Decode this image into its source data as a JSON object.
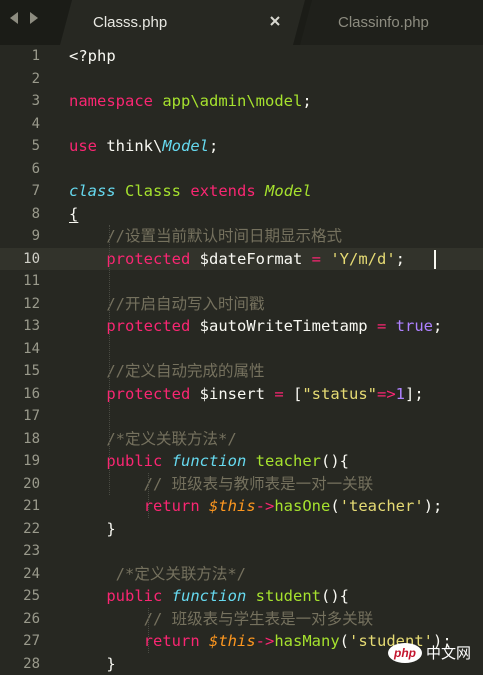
{
  "tabs": [
    {
      "label": "Classs.php"
    },
    {
      "label": "Classinfo.php"
    }
  ],
  "current_line": 10,
  "lines": [
    {
      "n": "1",
      "tokens": [
        {
          "t": "<?php",
          "c": "var"
        }
      ]
    },
    {
      "n": "2",
      "tokens": []
    },
    {
      "n": "3",
      "tokens": [
        {
          "t": "namespace",
          "c": "kw"
        },
        {
          "t": " ",
          "c": "var"
        },
        {
          "t": "app\\admin\\model",
          "c": "ns"
        },
        {
          "t": ";",
          "c": "var"
        }
      ]
    },
    {
      "n": "4",
      "tokens": []
    },
    {
      "n": "5",
      "tokens": [
        {
          "t": "use",
          "c": "kw"
        },
        {
          "t": " think\\",
          "c": "var"
        },
        {
          "t": "Model",
          "c": "typ"
        },
        {
          "t": ";",
          "c": "var"
        }
      ]
    },
    {
      "n": "6",
      "tokens": []
    },
    {
      "n": "7",
      "tokens": [
        {
          "t": "class",
          "c": "sto"
        },
        {
          "t": " ",
          "c": "var"
        },
        {
          "t": "Classs",
          "c": "cls"
        },
        {
          "t": " ",
          "c": "var"
        },
        {
          "t": "extends",
          "c": "kw"
        },
        {
          "t": " ",
          "c": "var"
        },
        {
          "t": "Model",
          "c": "cls ital"
        }
      ]
    },
    {
      "n": "8",
      "tokens": [
        {
          "t": "{",
          "c": "var ul"
        }
      ]
    },
    {
      "n": "9",
      "tokens": [
        {
          "t": "    ",
          "c": "var"
        },
        {
          "t": "//设置当前默认时间日期显示格式",
          "c": "com"
        }
      ]
    },
    {
      "n": "10",
      "tokens": [
        {
          "t": "    ",
          "c": "var"
        },
        {
          "t": "protected",
          "c": "kw"
        },
        {
          "t": " $dateFormat ",
          "c": "var"
        },
        {
          "t": "=",
          "c": "op"
        },
        {
          "t": " ",
          "c": "var"
        },
        {
          "t": "'Y/m/d'",
          "c": "str"
        },
        {
          "t": ";",
          "c": "var"
        }
      ]
    },
    {
      "n": "11",
      "tokens": []
    },
    {
      "n": "12",
      "tokens": [
        {
          "t": "    ",
          "c": "var"
        },
        {
          "t": "//开启自动写入时间戳",
          "c": "com"
        }
      ]
    },
    {
      "n": "13",
      "tokens": [
        {
          "t": "    ",
          "c": "var"
        },
        {
          "t": "protected",
          "c": "kw"
        },
        {
          "t": " $autoWriteTimetamp ",
          "c": "var"
        },
        {
          "t": "=",
          "c": "op"
        },
        {
          "t": " ",
          "c": "var"
        },
        {
          "t": "true",
          "c": "const"
        },
        {
          "t": ";",
          "c": "var"
        }
      ]
    },
    {
      "n": "14",
      "tokens": []
    },
    {
      "n": "15",
      "tokens": [
        {
          "t": "    ",
          "c": "var"
        },
        {
          "t": "//定义自动完成的属性",
          "c": "com"
        }
      ]
    },
    {
      "n": "16",
      "tokens": [
        {
          "t": "    ",
          "c": "var"
        },
        {
          "t": "protected",
          "c": "kw"
        },
        {
          "t": " $insert ",
          "c": "var"
        },
        {
          "t": "=",
          "c": "op"
        },
        {
          "t": " [",
          "c": "var"
        },
        {
          "t": "\"status\"",
          "c": "str"
        },
        {
          "t": "=>",
          "c": "op"
        },
        {
          "t": "1",
          "c": "num"
        },
        {
          "t": "];",
          "c": "var"
        }
      ]
    },
    {
      "n": "17",
      "tokens": []
    },
    {
      "n": "18",
      "tokens": [
        {
          "t": "    ",
          "c": "var"
        },
        {
          "t": "/*定义关联方法*/",
          "c": "com"
        }
      ]
    },
    {
      "n": "19",
      "tokens": [
        {
          "t": "    ",
          "c": "var"
        },
        {
          "t": "public",
          "c": "kw"
        },
        {
          "t": " ",
          "c": "var"
        },
        {
          "t": "function",
          "c": "sto"
        },
        {
          "t": " ",
          "c": "var"
        },
        {
          "t": "teacher",
          "c": "fn"
        },
        {
          "t": "(){",
          "c": "var"
        }
      ]
    },
    {
      "n": "20",
      "tokens": [
        {
          "t": "        ",
          "c": "var"
        },
        {
          "t": "// 班级表与教师表是一对一关联",
          "c": "com"
        }
      ]
    },
    {
      "n": "21",
      "tokens": [
        {
          "t": "        ",
          "c": "var"
        },
        {
          "t": "return",
          "c": "kw"
        },
        {
          "t": " ",
          "c": "var"
        },
        {
          "t": "$this",
          "c": "thisv"
        },
        {
          "t": "->",
          "c": "op"
        },
        {
          "t": "hasOne",
          "c": "fn"
        },
        {
          "t": "(",
          "c": "var"
        },
        {
          "t": "'teacher'",
          "c": "str"
        },
        {
          "t": ");",
          "c": "var"
        }
      ]
    },
    {
      "n": "22",
      "tokens": [
        {
          "t": "    }",
          "c": "var"
        }
      ]
    },
    {
      "n": "23",
      "tokens": []
    },
    {
      "n": "24",
      "tokens": [
        {
          "t": "     ",
          "c": "var"
        },
        {
          "t": "/*定义关联方法*/",
          "c": "com"
        }
      ]
    },
    {
      "n": "25",
      "tokens": [
        {
          "t": "    ",
          "c": "var"
        },
        {
          "t": "public",
          "c": "kw"
        },
        {
          "t": " ",
          "c": "var"
        },
        {
          "t": "function",
          "c": "sto"
        },
        {
          "t": " ",
          "c": "var"
        },
        {
          "t": "student",
          "c": "fn"
        },
        {
          "t": "(){",
          "c": "var"
        }
      ]
    },
    {
      "n": "26",
      "tokens": [
        {
          "t": "        ",
          "c": "var"
        },
        {
          "t": "// 班级表与学生表是一对多关联",
          "c": "com"
        }
      ]
    },
    {
      "n": "27",
      "tokens": [
        {
          "t": "        ",
          "c": "var"
        },
        {
          "t": "return",
          "c": "kw"
        },
        {
          "t": " ",
          "c": "var"
        },
        {
          "t": "$this",
          "c": "thisv"
        },
        {
          "t": "->",
          "c": "op"
        },
        {
          "t": "hasMany",
          "c": "fn"
        },
        {
          "t": "(",
          "c": "var"
        },
        {
          "t": "'student'",
          "c": "str"
        },
        {
          "t": ");",
          "c": "var"
        }
      ]
    },
    {
      "n": "28",
      "tokens": [
        {
          "t": "    }",
          "c": "var"
        }
      ]
    }
  ],
  "watermark": {
    "logo": "php",
    "text": "中文网"
  },
  "colors": {
    "background": "#272822",
    "keyword": "#f92672",
    "class_name": "#a6e22e",
    "storage": "#66d9ef",
    "string": "#e6db74",
    "constant": "#ae81ff",
    "comment": "#75715e",
    "this_var": "#fd971f"
  }
}
